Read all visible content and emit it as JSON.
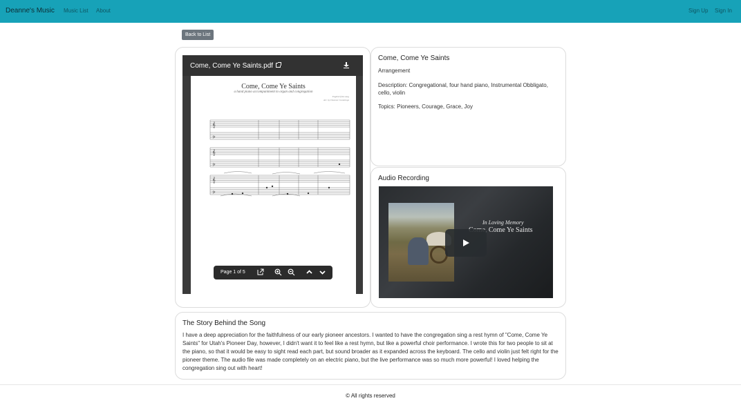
{
  "header": {
    "brand": "Deanne's Music",
    "nav": [
      "Music List",
      "About"
    ],
    "auth": [
      "Sign Up",
      "Sign In"
    ],
    "color": "#17a2b8"
  },
  "back_button": "Back to List",
  "pdf": {
    "filename": "Come, Come Ye Saints.pdf",
    "score_title": "Come, Come Ye Saints",
    "score_subtitle": "a hand piano accompaniment to organ and congregation",
    "score_credit_1": "English folk song",
    "score_credit_2": "Arr. by Deanne Cummings",
    "page_indicator": "Page 1 of 5"
  },
  "song": {
    "title": "Come, Come Ye Saints",
    "type": "Arrangement",
    "description": "Description: Congregational, four hand piano, Instrumental Obbligato, cello, violin",
    "topics": "Topics: Pioneers, Courage, Grace, Joy"
  },
  "audio": {
    "heading": "Audio Recording",
    "video_caption_1": "In Loving Memory",
    "video_caption_2": "Come, Come Ye Saints"
  },
  "story": {
    "heading": "The Story Behind the Song",
    "text": "I have a deep appreciation for the faithfulness of our early pioneer ancestors. I wanted to have the congregation sing a rest hymn of \"Come, Come Ye Saints\" for Utah's Pioneer Day, however, I didn't want it to feel like a rest hymn, but like a powerful choir performance. I wrote this for two people to sit at the piano, so that it would be easy to sight read each part, but sound broader as it expanded across the keyboard. The cello and violin just felt right for the pioneer theme. The audio file was made completely on an electric piano, but the live performance was so much more powerful! I loved helping the congregation sing out with heart!"
  },
  "footer": "© All rights reserved"
}
